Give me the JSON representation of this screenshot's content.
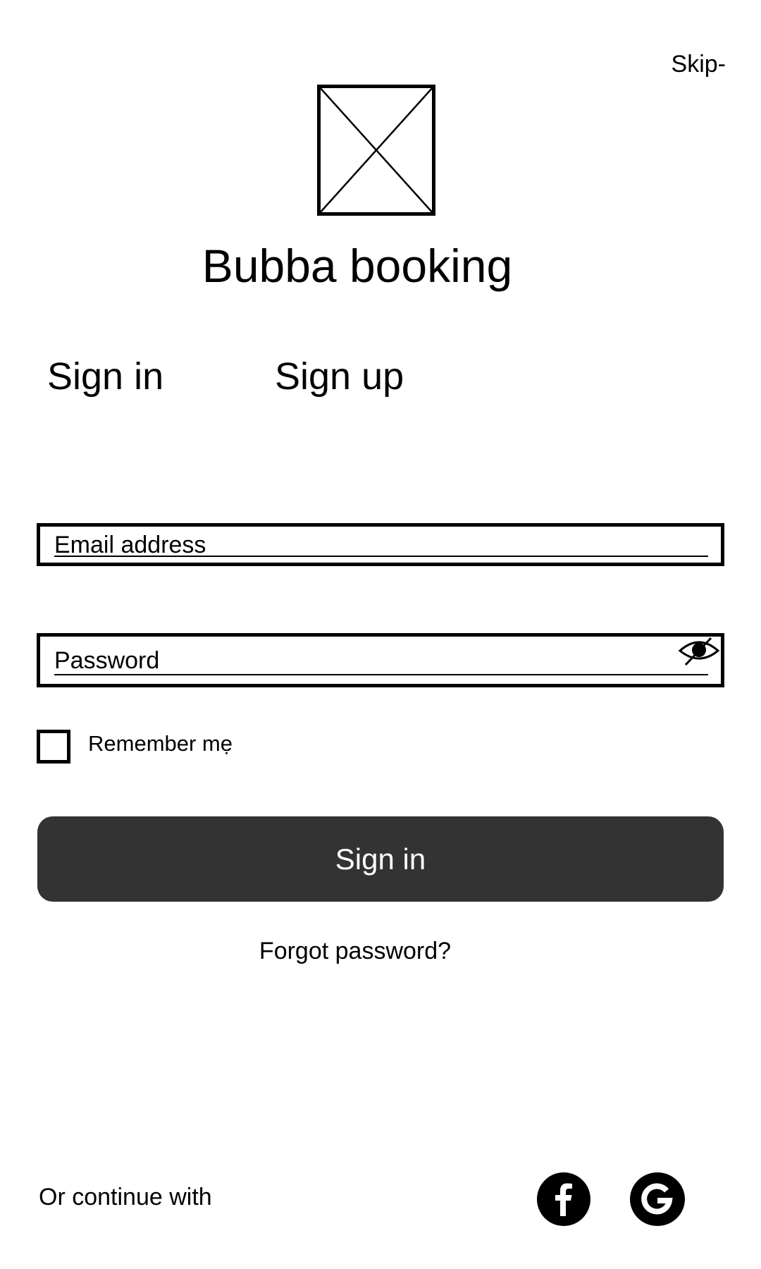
{
  "header": {
    "skip_label": "Skip-"
  },
  "brand": {
    "logo_icon": "image-placeholder-icon",
    "title": "Bubba booking"
  },
  "tabs": [
    {
      "label": "Sign in"
    },
    {
      "label": "Sign up"
    }
  ],
  "form": {
    "email_placeholder": "Email address",
    "password_placeholder": "Password",
    "password_toggle_icon": "eye-slash-icon",
    "remember_label": "Remember mẹ",
    "remember_checked": false,
    "submit_label": "Sign in",
    "forgot_label": "Forgot password?"
  },
  "social": {
    "label": "Or continue with",
    "providers": [
      {
        "icon": "facebook-icon"
      },
      {
        "icon": "google-icon"
      }
    ]
  },
  "colors": {
    "button_bg": "#333333",
    "button_text": "#ffffff",
    "text": "#000000",
    "background": "#ffffff"
  }
}
